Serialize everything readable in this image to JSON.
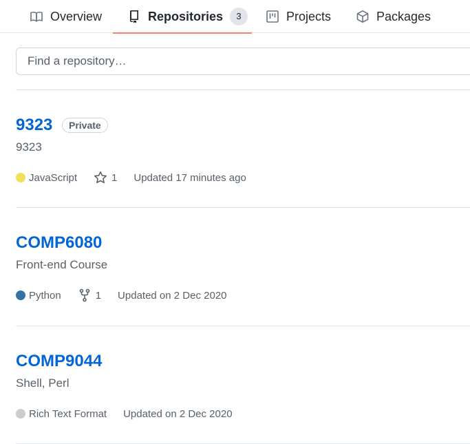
{
  "tabs": [
    {
      "label": "Overview",
      "icon": "book-icon",
      "active": false
    },
    {
      "label": "Repositories",
      "icon": "repo-icon",
      "active": true,
      "count": "3"
    },
    {
      "label": "Projects",
      "icon": "project-board-icon",
      "active": false
    },
    {
      "label": "Packages",
      "icon": "package-icon",
      "active": false
    }
  ],
  "search": {
    "placeholder": "Find a repository…",
    "value": ""
  },
  "repos": [
    {
      "name": "9323",
      "badge": "Private",
      "description": "9323",
      "language": "JavaScript",
      "language_color": "#f1e05a",
      "stars": "1",
      "updated": "Updated 17 minutes ago"
    },
    {
      "name": "COMP6080",
      "description": "Front-end Course",
      "language": "Python",
      "language_color": "#3572A5",
      "forks": "1",
      "updated": "Updated on 2 Dec 2020"
    },
    {
      "name": "COMP9044",
      "description": "Shell, Perl",
      "language": "Rich Text Format",
      "language_color": "#cccccc",
      "updated": "Updated on 2 Dec 2020"
    }
  ],
  "colors": {
    "link": "#0366d6",
    "active_tab_underline": "#f9826c",
    "muted_text": "#586069",
    "border": "#e1e4e8"
  }
}
